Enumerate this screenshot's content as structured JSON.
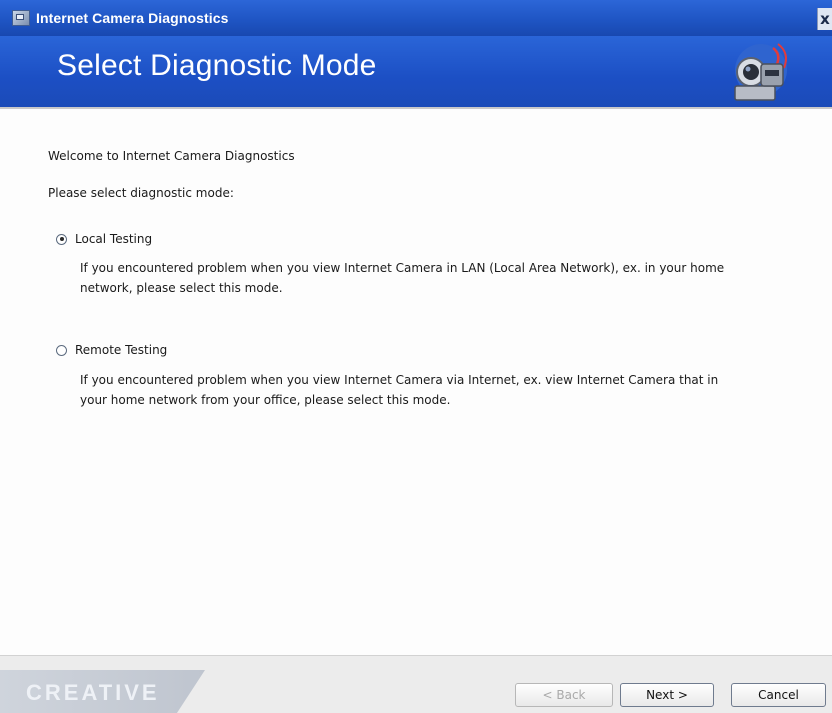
{
  "window": {
    "title": "Internet Camera Diagnostics",
    "close_glyph": "x"
  },
  "header": {
    "title": "Select Diagnostic Mode",
    "icon": "network-camera-icon"
  },
  "content": {
    "welcome": "Welcome to Internet Camera Diagnostics",
    "prompt": "Please select diagnostic mode:",
    "options": [
      {
        "label": "Local Testing",
        "selected": true,
        "desc_line1": "If you encountered problem when you view Internet Camera in LAN (Local Area Network), ex. in your home",
        "desc_line2": "network, please select this mode."
      },
      {
        "label": "Remote Testing",
        "selected": false,
        "desc_line1": "If you encountered problem when you view Internet Camera via Internet, ex. view Internet Camera that in",
        "desc_line2": "your home network from your office, please select this mode."
      }
    ]
  },
  "footer": {
    "brand": "CREATIVE",
    "back_label": "< Back",
    "next_label": "Next >",
    "cancel_label": "Cancel"
  },
  "colors": {
    "header_blue": "#1f55c4",
    "dialog_bg": "#fdfdfd"
  }
}
